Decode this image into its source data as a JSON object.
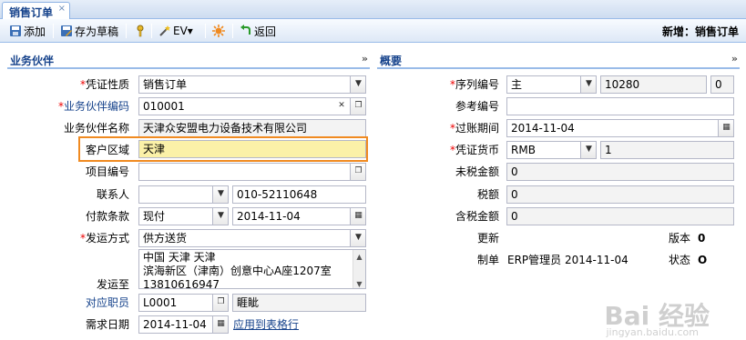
{
  "tab": {
    "title": "销售订单",
    "close": "×"
  },
  "toolbar": {
    "add": "添加",
    "save_draft": "存为草稿",
    "ev": "EV▾",
    "back": "返回",
    "mode": "新增：销售订单"
  },
  "left": {
    "title": "业务伙伴",
    "fields": {
      "voucher_type": {
        "label": "凭证性质",
        "value": "销售订单"
      },
      "partner_code": {
        "label": "业务伙伴编码",
        "value": "010001"
      },
      "partner_name": {
        "label": "业务伙伴名称",
        "value": "天津众安盟电力设备技术有限公司"
      },
      "customer_region": {
        "label": "客户区域",
        "value": "天津"
      },
      "project_no": {
        "label": "项目编号",
        "value": ""
      },
      "contact": {
        "label": "联系人",
        "value": "",
        "phone": "010-52110648"
      },
      "payment_terms": {
        "label": "付款条款",
        "value": "现付",
        "date": "2014-11-04"
      },
      "shipping_method": {
        "label": "发运方式",
        "value": "供方送货"
      },
      "ship_to": {
        "label": "发运至",
        "line1": "中国 天津 天津",
        "line2": "滨海新区（津南）创意中心A座1207室",
        "line3": "13810616947"
      },
      "staff": {
        "label": "对应职员",
        "value": "L0001",
        "name": "睚眦"
      },
      "required_date": {
        "label": "需求日期",
        "value": "2014-11-04",
        "apply": "应用到表格行"
      }
    }
  },
  "right": {
    "title": "概要",
    "fields": {
      "serial": {
        "label": "序列编号",
        "prefix": "主",
        "value": "10280",
        "sub": "0"
      },
      "ref_no": {
        "label": "参考编号",
        "value": ""
      },
      "post_period": {
        "label": "过账期间",
        "value": "2014-11-04"
      },
      "currency": {
        "label": "凭证货币",
        "value": "RMB",
        "rate": "1"
      },
      "pre_tax": {
        "label": "未税金额",
        "value": "0"
      },
      "tax": {
        "label": "税额",
        "value": "0"
      },
      "with_tax": {
        "label": "含税金额",
        "value": "0"
      },
      "update": {
        "label": "更新",
        "version_label": "版本",
        "version": "0"
      },
      "creator": {
        "label": "制单",
        "value": "ERP管理员 2014-11-04",
        "status_label": "状态",
        "status": "O"
      }
    }
  },
  "watermark": {
    "text": "Bai 经验",
    "url": "jingyan.baidu.com"
  },
  "colors": {
    "accent": "#15428b",
    "required": "#ee0000",
    "highlight": "#f08a20"
  }
}
